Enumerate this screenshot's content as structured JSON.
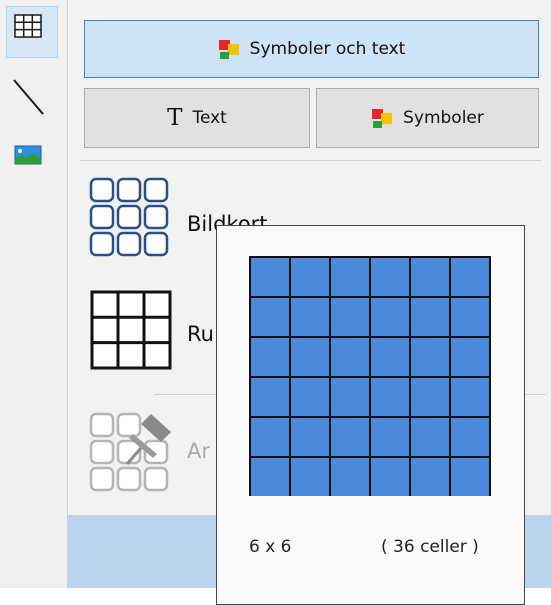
{
  "toolbar": {
    "tools": [
      {
        "name": "table-tool",
        "icon": "table-grid-icon",
        "active": true
      },
      {
        "name": "line-tool",
        "icon": "diagonal-line-icon",
        "active": false
      },
      {
        "name": "image-tool",
        "icon": "landscape-image-icon",
        "active": false
      }
    ]
  },
  "panel": {
    "symbols_and_text_label": "Symboler och text",
    "text_glyph": "T",
    "text_label": "Text",
    "symbols_label": "Symboler",
    "items": [
      {
        "label": "Bildkort",
        "icon": "picture-cards-icon",
        "enabled": true
      },
      {
        "label": "Ru",
        "icon": "grid-table-icon",
        "enabled": true
      },
      {
        "label": "Ar",
        "icon": "pinned-cards-icon",
        "enabled": false
      }
    ]
  },
  "grid_popup": {
    "rows": 6,
    "columns": 6,
    "dimensions_label": "6 x 6",
    "cells_label": "( 36 celler )",
    "cell_color": "#4a89dc",
    "line_color": "#111111"
  },
  "colors": {
    "accent_border": "#3b86d4",
    "selected_bg": "#cfe3f7",
    "symbol_red": "#e8252a",
    "symbol_yellow": "#f5c400",
    "symbol_green": "#2e9b3c"
  }
}
